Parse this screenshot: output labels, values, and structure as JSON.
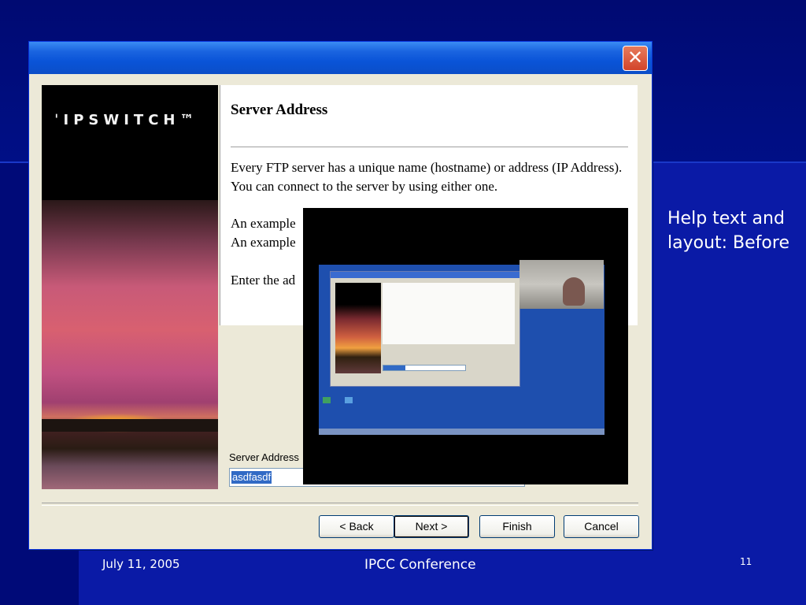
{
  "slide": {
    "side_text_line1": "Help text and",
    "side_text_line2": "layout: Before",
    "footer_date": "July 11, 2005",
    "footer_title": "IPCC Conference",
    "page_number": "11"
  },
  "dialog": {
    "close_icon": "close-icon",
    "logo": "IPSWITCH",
    "heading": "Server Address",
    "paragraph1": "Every FTP server has a unique name (hostname) or address (IP Address). You can connect to the server by using either one.",
    "paragraph2": "An example",
    "paragraph3": "An example",
    "paragraph4": "Enter the ad",
    "field_label": "Server Address",
    "field_value": "asdfasdf",
    "buttons": {
      "back": "< Back",
      "next": "Next >",
      "finish": "Finish",
      "cancel": "Cancel"
    }
  },
  "colors": {
    "slide_background": "#000c80",
    "titlebar": "#0a54d8",
    "dialog_face": "#ece9d8",
    "selection": "#316ac5"
  }
}
